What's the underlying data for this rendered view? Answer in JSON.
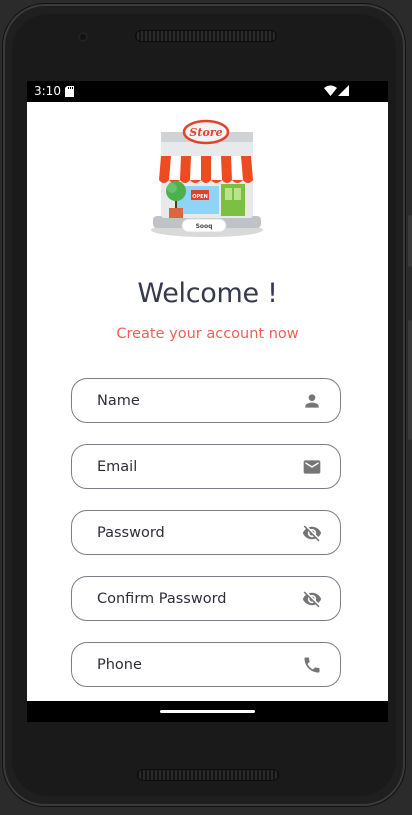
{
  "status_bar": {
    "time": "3:10"
  },
  "logo": {
    "sign_text": "Store",
    "plate_text": "Sooq",
    "open_sign": "OPEN"
  },
  "header": {
    "title": "Welcome !",
    "subtitle": "Create your account now"
  },
  "form": {
    "name": {
      "placeholder": "Name",
      "icon": "person-icon"
    },
    "email": {
      "placeholder": "Email",
      "icon": "email-icon"
    },
    "password": {
      "placeholder": "Password",
      "icon": "visibility-off-icon"
    },
    "confirm_password": {
      "placeholder": "Confirm Password",
      "icon": "visibility-off-icon"
    },
    "phone": {
      "placeholder": "Phone",
      "icon": "phone-icon"
    }
  },
  "colors": {
    "title": "#363a4e",
    "subtitle": "#ef5f5a",
    "field_border": "#7d7d88",
    "icon": "#757575"
  }
}
